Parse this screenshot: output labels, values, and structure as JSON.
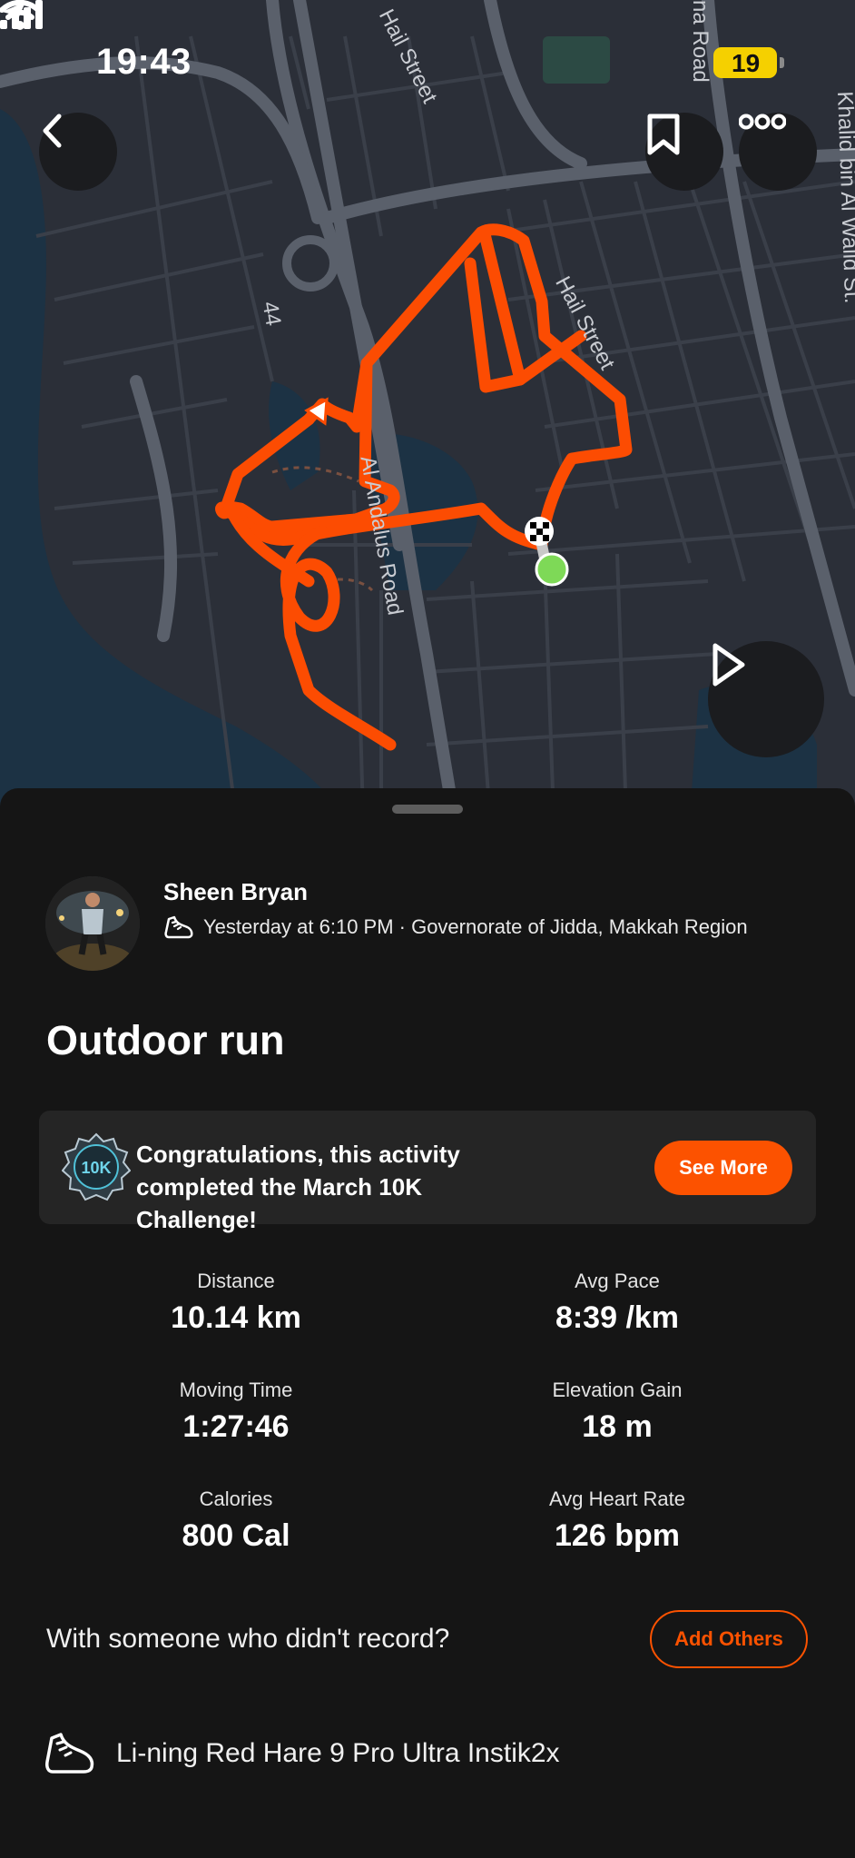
{
  "status_bar": {
    "time": "19:43",
    "battery": "19"
  },
  "map": {
    "street_labels": [
      "Hail Street",
      "Hail Street",
      "Al Andalus Road",
      "Khalid bin Al Walid St.",
      "44",
      "na Road"
    ],
    "route_color": "#fc4c02",
    "start_color": "#7ed957"
  },
  "buttons": {
    "back_icon": "chevron-left-icon",
    "bookmark_icon": "bookmark-icon",
    "more_icon": "more-icon",
    "play_icon": "play-icon"
  },
  "activity": {
    "athlete_name": "Sheen Bryan",
    "meta": "Yesterday at 6:10 PM · Governorate of Jidda, Makkah Region",
    "title": "Outdoor run"
  },
  "challenge": {
    "badge_text": "10K",
    "message": "Congratulations, this activity completed the March 10K Challenge!",
    "cta": "See More"
  },
  "stats": [
    {
      "label": "Distance",
      "value": "10.14 km"
    },
    {
      "label": "Avg Pace",
      "value": "8:39 /km"
    },
    {
      "label": "Moving Time",
      "value": "1:27:46"
    },
    {
      "label": "Elevation Gain",
      "value": "18 m"
    },
    {
      "label": "Calories",
      "value": "800 Cal"
    },
    {
      "label": "Avg Heart Rate",
      "value": "126 bpm"
    }
  ],
  "others": {
    "prompt": "With someone who didn't record?",
    "button": "Add Others"
  },
  "gear": {
    "shoe": "Li-ning Red Hare 9 Pro Ultra Instik2x"
  },
  "colors": {
    "accent": "#fc5200",
    "background": "#151515",
    "card": "#252525",
    "water": "#1d3345",
    "land": "#2b2f38"
  }
}
